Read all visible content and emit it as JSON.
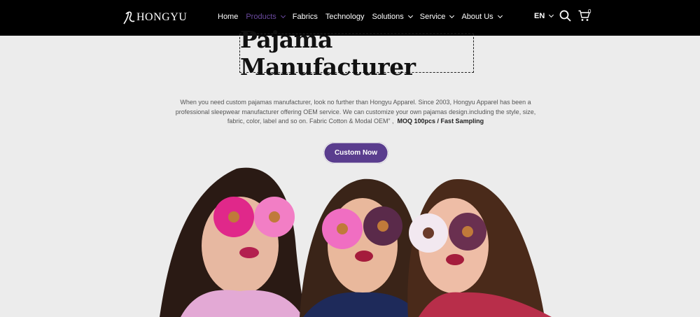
{
  "header": {
    "logo_text": "HONGYU",
    "nav": [
      {
        "label": "Home",
        "dropdown": false,
        "active": false
      },
      {
        "label": "Products",
        "dropdown": true,
        "active": true
      },
      {
        "label": "Fabrics",
        "dropdown": false,
        "active": false
      },
      {
        "label": "Technology",
        "dropdown": false,
        "active": false
      },
      {
        "label": "Solutions",
        "dropdown": true,
        "active": false
      },
      {
        "label": "Service",
        "dropdown": true,
        "active": false
      },
      {
        "label": "About Us",
        "dropdown": true,
        "active": false
      }
    ],
    "language": "EN",
    "cart_count": "0",
    "icons": [
      "search-icon",
      "cart-icon",
      "chevron-down-icon"
    ]
  },
  "hero": {
    "title": "Pajama Manufacturer",
    "description": "When you need custom pajamas manufacturer, look no further than Hongyu Apparel. Since 2003, Hongyu Apparel has been a professional sleepwear manufacturer offering OEM service. We can customize your own pajamas design.including the style, size, fabric, color, label and so on. Fabric Cotton & Modal OEM” ,",
    "highlight": "MOQ 100pcs / Fast Sampling",
    "cta_label": "Custom Now",
    "image_alt": "Three women holding donuts over their eyes"
  },
  "colors": {
    "header_bg": "#000000",
    "accent": "#5a3d8e",
    "active_nav": "#6b4aa0",
    "page_bg": "#ececec"
  }
}
